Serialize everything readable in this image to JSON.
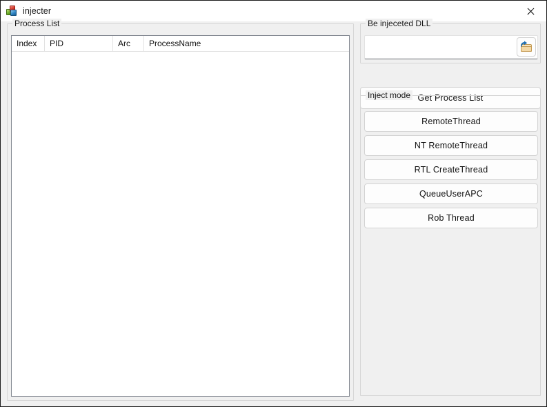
{
  "window": {
    "title": "injecter",
    "icon": "app-blocks-icon",
    "close_label": "✕"
  },
  "process_group": {
    "label": "Process List",
    "columns": [
      "Index",
      "PID",
      "Arc",
      "ProcessName"
    ],
    "rows": []
  },
  "dll_group": {
    "label": "Be injeceted DLL",
    "input_value": "",
    "input_placeholder": "",
    "browse_icon": "open-folder-icon"
  },
  "actions": {
    "get_process_list": "Get Process List"
  },
  "inject_group": {
    "label": "Inject mode",
    "buttons": [
      {
        "label": "RemoteThread"
      },
      {
        "label": "NT RemoteThread"
      },
      {
        "label": "RTL CreateThread"
      },
      {
        "label": "QueueUserAPC"
      },
      {
        "label": "Rob  Thread"
      }
    ]
  },
  "colors": {
    "window_background": "#f0f0f0",
    "titlebar_background": "#ffffff",
    "list_background": "#ffffff",
    "group_border": "#d6d6d6",
    "list_border": "#828790",
    "button_face": "#fdfdfd",
    "text": "#111111"
  }
}
